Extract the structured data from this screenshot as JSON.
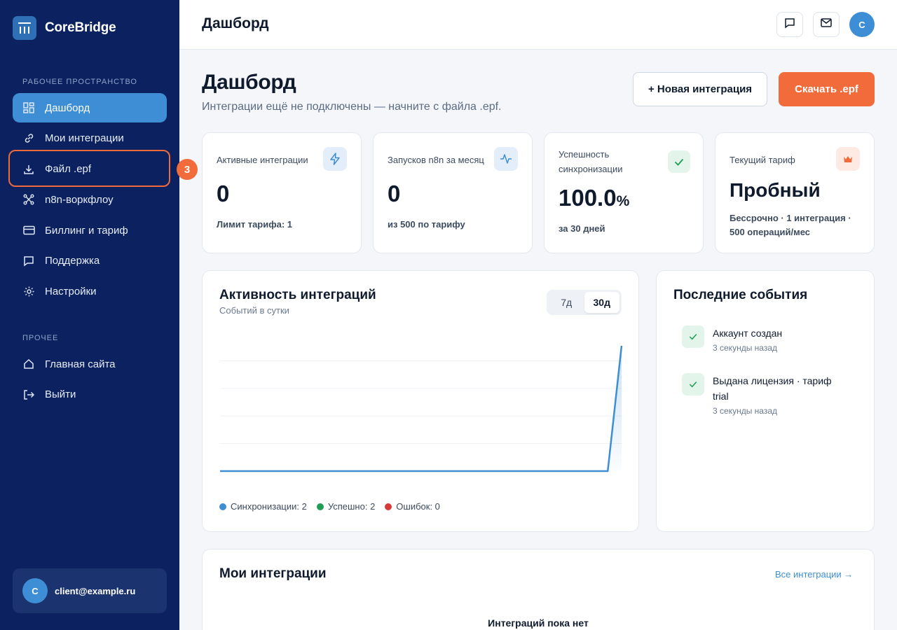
{
  "brand": {
    "name": "CoreBridge"
  },
  "sidebar": {
    "section_workspace": "РАБОЧЕЕ ПРОСТРАНСТВО",
    "section_other": "ПРОЧЕЕ",
    "items": [
      {
        "label": "Дашборд",
        "icon": "dashboard-icon"
      },
      {
        "label": "Мои интеграции",
        "icon": "link-icon"
      },
      {
        "label": "Файл .epf",
        "icon": "download-icon"
      },
      {
        "label": "n8n-воркфлоу",
        "icon": "workflow-icon"
      },
      {
        "label": "Биллинг и тариф",
        "icon": "credit-card-icon"
      },
      {
        "label": "Поддержка",
        "icon": "chat-icon"
      },
      {
        "label": "Настройки",
        "icon": "gear-icon"
      }
    ],
    "other_items": [
      {
        "label": "Главная сайта",
        "icon": "home-icon"
      },
      {
        "label": "Выйти",
        "icon": "logout-icon"
      }
    ],
    "highlight_badge": "3",
    "user": {
      "initial": "C",
      "email": "client@example.ru"
    }
  },
  "topbar": {
    "title": "Дашборд",
    "avatar_initial": "C"
  },
  "main": {
    "title": "Дашборд",
    "subtitle": "Интеграции ещё не подключены — начните с файла .epf.",
    "new_integration_label": "+ Новая интеграция",
    "download_label": "Скачать .epf"
  },
  "stats": [
    {
      "label": "Активные интеграции",
      "value": "0",
      "note": "Лимит тарифа: 1",
      "icon": "bolt-icon"
    },
    {
      "label": "Запусков n8n за месяц",
      "value": "0",
      "note": "из 500 по тарифу",
      "icon": "pulse-icon"
    },
    {
      "label": "Успешность синхронизации",
      "value": "100.0",
      "unit": "%",
      "note": "за 30 дней",
      "icon": "check-icon"
    },
    {
      "label": "Текущий тариф",
      "value": "Пробный",
      "note": "Бессрочно · 1 интеграция · 500 операций/мес",
      "icon": "crown-icon"
    }
  ],
  "activity": {
    "title": "Активность интеграций",
    "subtitle": "Событий в сутки",
    "ranges": [
      "7д",
      "30д"
    ],
    "active_range": "30д",
    "legend": [
      {
        "label": "Синхронизации: 2",
        "color": "#3d8ed4"
      },
      {
        "label": "Успешно: 2",
        "color": "#1f9d55"
      },
      {
        "label": "Ошибок: 0",
        "color": "#d63a3a"
      }
    ]
  },
  "chart_data": {
    "type": "area",
    "x": [
      1,
      2,
      3,
      4,
      5,
      6,
      7,
      8,
      9,
      10,
      11,
      12,
      13,
      14,
      15,
      16,
      17,
      18,
      19,
      20,
      21,
      22,
      23,
      24,
      25,
      26,
      27,
      28,
      29,
      30
    ],
    "series": [
      {
        "name": "Синхронизации",
        "values": [
          0,
          0,
          0,
          0,
          0,
          0,
          0,
          0,
          0,
          0,
          0,
          0,
          0,
          0,
          0,
          0,
          0,
          0,
          0,
          0,
          0,
          0,
          0,
          0,
          0,
          0,
          0,
          0,
          0,
          2
        ]
      }
    ],
    "ylim": [
      0,
      2
    ],
    "grid": true,
    "legend_placement": "bottom-left"
  },
  "events": {
    "title": "Последние события",
    "items": [
      {
        "text": "Аккаунт создан",
        "time": "3 секунды назад"
      },
      {
        "text": "Выдана лицензия · тариф trial",
        "time": "3 секунды назад"
      }
    ]
  },
  "integrations": {
    "title": "Мои интеграции",
    "all_link": "Все интеграции →",
    "empty_title": "Интеграций пока нет"
  }
}
